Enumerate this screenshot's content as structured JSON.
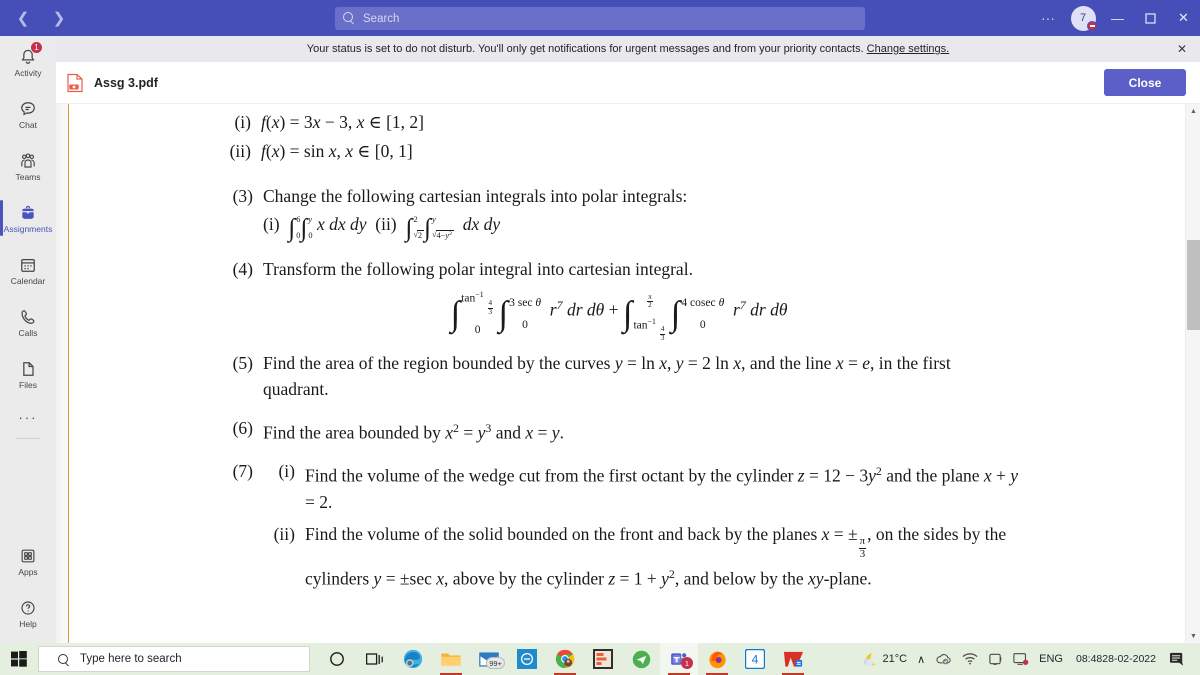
{
  "titlebar": {
    "back_icon": "chevron-left-icon",
    "forward_icon": "chevron-right-icon",
    "search_placeholder": "Search",
    "overflow_label": "···",
    "avatar_initials": "7",
    "minimize_label": "—",
    "maximize_label": "❐",
    "close_label": "✕",
    "background": "#464EB8"
  },
  "status_banner": {
    "message": "Your status is set to do not disturb. You'll only get notifications for urgent messages and from your priority contacts.",
    "link": "Change settings.",
    "close_label": "✕"
  },
  "rail": {
    "items": [
      {
        "label": "Activity",
        "icon": "bell-icon",
        "badge": "1",
        "active": false
      },
      {
        "label": "Chat",
        "icon": "chat-icon",
        "badge": "",
        "active": false
      },
      {
        "label": "Teams",
        "icon": "teams-people-icon",
        "badge": "",
        "active": false
      },
      {
        "label": "Assignments",
        "icon": "assignments-bag-icon",
        "badge": "",
        "active": true
      },
      {
        "label": "Calendar",
        "icon": "calendar-icon",
        "badge": "",
        "active": false
      },
      {
        "label": "Calls",
        "icon": "phone-icon",
        "badge": "",
        "active": false
      },
      {
        "label": "Files",
        "icon": "file-icon",
        "badge": "",
        "active": false
      }
    ],
    "more_label": "···",
    "bottom": [
      {
        "label": "Apps",
        "icon": "apps-grid-icon"
      },
      {
        "label": "Help",
        "icon": "question-circle-icon"
      }
    ],
    "accent": "#4B53BC"
  },
  "filebar": {
    "file_name": "Assg 3.pdf",
    "file_icon": "pdf-file-icon",
    "close_label": "Close",
    "close_color": "#5B5FC7"
  },
  "document": {
    "rule_color": "#D99A2B",
    "items": [
      {
        "num": "(i)",
        "level": 2,
        "html": "<span class=\"mi\">f</span>(<span class=\"mi\">x</span>) = 3<span class=\"mi\">x</span> &minus; 3, <span class=\"mi\">x</span> &isin; [1, 2]"
      },
      {
        "num": "(ii)",
        "level": 2,
        "html": "<span class=\"mi\">f</span>(<span class=\"mi\">x</span>) = sin <span class=\"mi\">x</span>, <span class=\"mi\">x</span> &isin; [0, 1]"
      },
      {
        "num": "(3)",
        "level": 1,
        "html": "Change the following cartesian integrals into polar integrals:"
      },
      {
        "num": "(i)",
        "level": 3,
        "html": "integral-row-3"
      },
      {
        "num": "(4)",
        "level": 1,
        "html": "Transform the following polar integral into cartesian integral."
      },
      {
        "num": "",
        "level": 0,
        "html": "display-integral-4"
      },
      {
        "num": "(5)",
        "level": 1,
        "html": "Find the area of the region bounded by the curves <span class=\"mi\">y</span> = ln <span class=\"mi\">x</span>, <span class=\"mi\">y</span> = 2 ln <span class=\"mi\">x</span>, and the line <span class=\"mi\">x</span> = <span class=\"mi\">e</span>, in the first quadrant."
      },
      {
        "num": "(6)",
        "level": 1,
        "html": "Find the area bounded by <span class=\"mi\">x</span><span class=\"sup\">2</span> = <span class=\"mi\">y</span><span class=\"sup\">3</span> and <span class=\"mi\">x</span> = <span class=\"mi\">y</span>."
      },
      {
        "num": "(7)",
        "level": 1,
        "html": "group-7"
      }
    ],
    "q1_i": "(i)",
    "q1_ii": "(ii)",
    "q3_num": "(3)",
    "q3_text": "Change the following cartesian integrals into polar integrals:",
    "q4_num": "(4)",
    "q4_text": "Transform the following polar integral into cartesian integral.",
    "q5_num": "(5)",
    "q5_line1": "Find the area of the region bounded by the curves",
    "q5_line2": "in the first quadrant.",
    "q6_num": "(6)",
    "q7_num": "(7)",
    "q7i_num": "(i)",
    "q7ii_num": "(ii)"
  },
  "scrollbar": {
    "up_arrow": "▲",
    "down_arrow": "▼"
  },
  "taskbar": {
    "background": "#E4EFE0",
    "start_icon": "windows-start-icon",
    "search_placeholder": "Type here to search",
    "cortana_icon": "cortana-circle-icon",
    "taskview_icon": "task-view-icon",
    "apps": [
      {
        "name": "microsoft-edge-icon",
        "badge": "",
        "open": false,
        "active": false
      },
      {
        "name": "file-explorer-icon",
        "badge": "",
        "open": true,
        "active": false
      },
      {
        "name": "mail-icon",
        "badge": "99+",
        "open": false,
        "active": false
      },
      {
        "name": "blue-app-icon",
        "badge": "",
        "open": false,
        "active": false
      },
      {
        "name": "google-chrome-icon",
        "badge": "",
        "open": true,
        "active": false
      },
      {
        "name": "orange-app-icon",
        "badge": "",
        "open": false,
        "active": false
      },
      {
        "name": "telegram-icon",
        "badge": "",
        "open": false,
        "active": false
      },
      {
        "name": "microsoft-teams-icon",
        "badge": "1",
        "open": true,
        "active": true
      },
      {
        "name": "mozilla-firefox-icon",
        "badge": "",
        "open": true,
        "active": false
      },
      {
        "name": "blue-four-app-icon",
        "badge": "",
        "open": false,
        "active": false
      },
      {
        "name": "wps-office-icon",
        "badge": "",
        "open": true,
        "active": false
      }
    ],
    "tray": {
      "weather_icon": "moon-weather-icon",
      "temperature": "21°C",
      "chevron": "∧",
      "cloud_icon": "onedrive-cloud-icon",
      "wifi_icon": "wifi-icon",
      "battery_icon": "battery-icon",
      "screen_icon": "display-alert-icon",
      "language": "ENG",
      "time": "08:48",
      "date": "28-02-2022",
      "notification_icon": "notification-center-icon"
    }
  }
}
